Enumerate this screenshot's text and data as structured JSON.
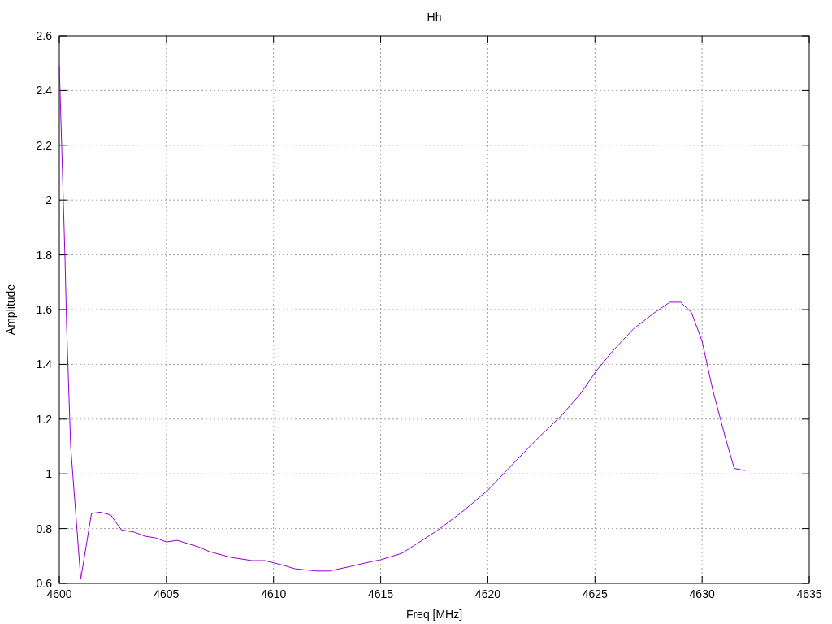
{
  "chart": {
    "chart_data": {
      "type": "line",
      "title": "Hh",
      "xlabel": "Freq [MHz]",
      "ylabel": "Amplitude",
      "x": [
        4600,
        4600.27,
        4600.34,
        4600.53,
        4601,
        4601.5,
        4601.9,
        4602.4,
        4602.9,
        4603.5,
        4604,
        4604.5,
        4605,
        4605.5,
        4606,
        4606.5,
        4607,
        4608,
        4609,
        4609.6,
        4610.5,
        4611,
        4612,
        4612.6,
        4613.6,
        4614.6,
        4615,
        4616,
        4616.6,
        4617.7,
        4618.9,
        4620,
        4621.1,
        4622.3,
        4623.4,
        4624.3,
        4625.1,
        4625.9,
        4626.8,
        4627.8,
        4628.5,
        4629,
        4629.5,
        4630,
        4630.5,
        4631.1,
        4631.5,
        4632
      ],
      "series": [
        {
          "color": "#9400d3",
          "values": [
            2.49,
            1.78,
            1.54,
            1.1,
            0.615,
            0.855,
            0.86,
            0.85,
            0.795,
            0.787,
            0.772,
            0.766,
            0.751,
            0.757,
            0.745,
            0.733,
            0.716,
            0.695,
            0.683,
            0.683,
            0.665,
            0.653,
            0.645,
            0.645,
            0.662,
            0.68,
            0.686,
            0.71,
            0.74,
            0.796,
            0.867,
            0.94,
            1.03,
            1.128,
            1.21,
            1.29,
            1.38,
            1.455,
            1.53,
            1.59,
            1.627,
            1.627,
            1.59,
            1.485,
            1.306,
            1.128,
            1.02,
            1.012
          ]
        }
      ],
      "grid": true,
      "xlim": [
        4600,
        4635
      ],
      "ylim": [
        0.6,
        2.6
      ],
      "xticks": [
        4600,
        4605,
        4610,
        4615,
        4620,
        4625,
        4630,
        4635
      ],
      "yticks": [
        0.6,
        0.8,
        1,
        1.2,
        1.4,
        1.6,
        1.8,
        2,
        2.2,
        2.4,
        2.6
      ]
    }
  }
}
